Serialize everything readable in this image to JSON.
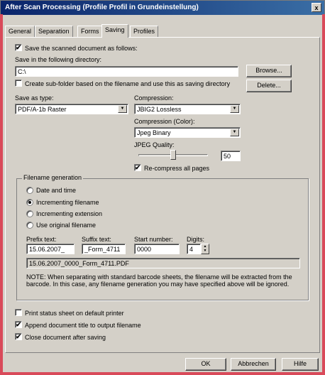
{
  "window": {
    "title": "After Scan Processing (Profile Profil in Grundeinstellung)",
    "close_glyph": "x"
  },
  "tabs": [
    {
      "label": "General"
    },
    {
      "label": "Separation"
    },
    {
      "label": "Forms"
    },
    {
      "label": "Saving",
      "active": true
    },
    {
      "label": "Profiles"
    }
  ],
  "saving": {
    "save_scanned": {
      "label": "Save the scanned document as follows:",
      "checked": true
    },
    "directory_label": "Save in the following directory:",
    "directory_value": "C:\\",
    "browse_label": "Browse...",
    "delete_label": "Delete...",
    "subfolder": {
      "label": "Create sub-folder based on the filename and use this as saving directory",
      "checked": false
    },
    "save_type_label": "Save as type:",
    "save_type_value": "PDF/A-1b Raster",
    "compression_label": "Compression:",
    "compression_value": "JBIG2 Lossless",
    "compression_color_label": "Compression (Color):",
    "compression_color_value": "Jpeg Binary",
    "jpeg_quality_label": "JPEG Quality:",
    "jpeg_quality_value": "50",
    "jpeg_quality_level": 0.5,
    "recompress": {
      "label": "Re-compress all pages",
      "checked": true
    }
  },
  "filename_generation": {
    "title": "Filename generation",
    "options": [
      {
        "label": "Date and time",
        "selected": false
      },
      {
        "label": "Incrementing filename",
        "selected": true
      },
      {
        "label": "Incrementing extension",
        "selected": false
      },
      {
        "label": "Use original filename",
        "selected": false
      }
    ],
    "prefix_label": "Prefix text:",
    "prefix_value": "15.06.2007_",
    "suffix_label": "Suffix text:",
    "suffix_value": "_Form_4711",
    "start_label": "Start number:",
    "start_value": "0000",
    "digits_label": "Digits:",
    "digits_value": "4",
    "preview": "15.06.2007_0000_Form_4711.PDF",
    "note": "NOTE: When separating with standard barcode sheets, the filename will be extracted from the barcode. In this case, any filename generation you may have specified above will be ignored."
  },
  "options": {
    "print_status": {
      "label": "Print status sheet on default printer",
      "checked": false
    },
    "append_title": {
      "label": "Append document title to output filename",
      "checked": true
    },
    "close_doc": {
      "label": "Close document after saving",
      "checked": true
    }
  },
  "footer": {
    "ok_label": "OK",
    "cancel_label": "Abbrechen",
    "help_label": "Hilfe"
  },
  "icons": {
    "check": "✔",
    "combo_arrow": "▼",
    "spin_up": "▲",
    "spin_down": "▼"
  },
  "colors": {
    "titlebar_start": "#0a246a",
    "titlebar_end": "#3a6ea5",
    "dialog_face": "#d4d0c8",
    "outer_frame": "#d94a5a"
  }
}
